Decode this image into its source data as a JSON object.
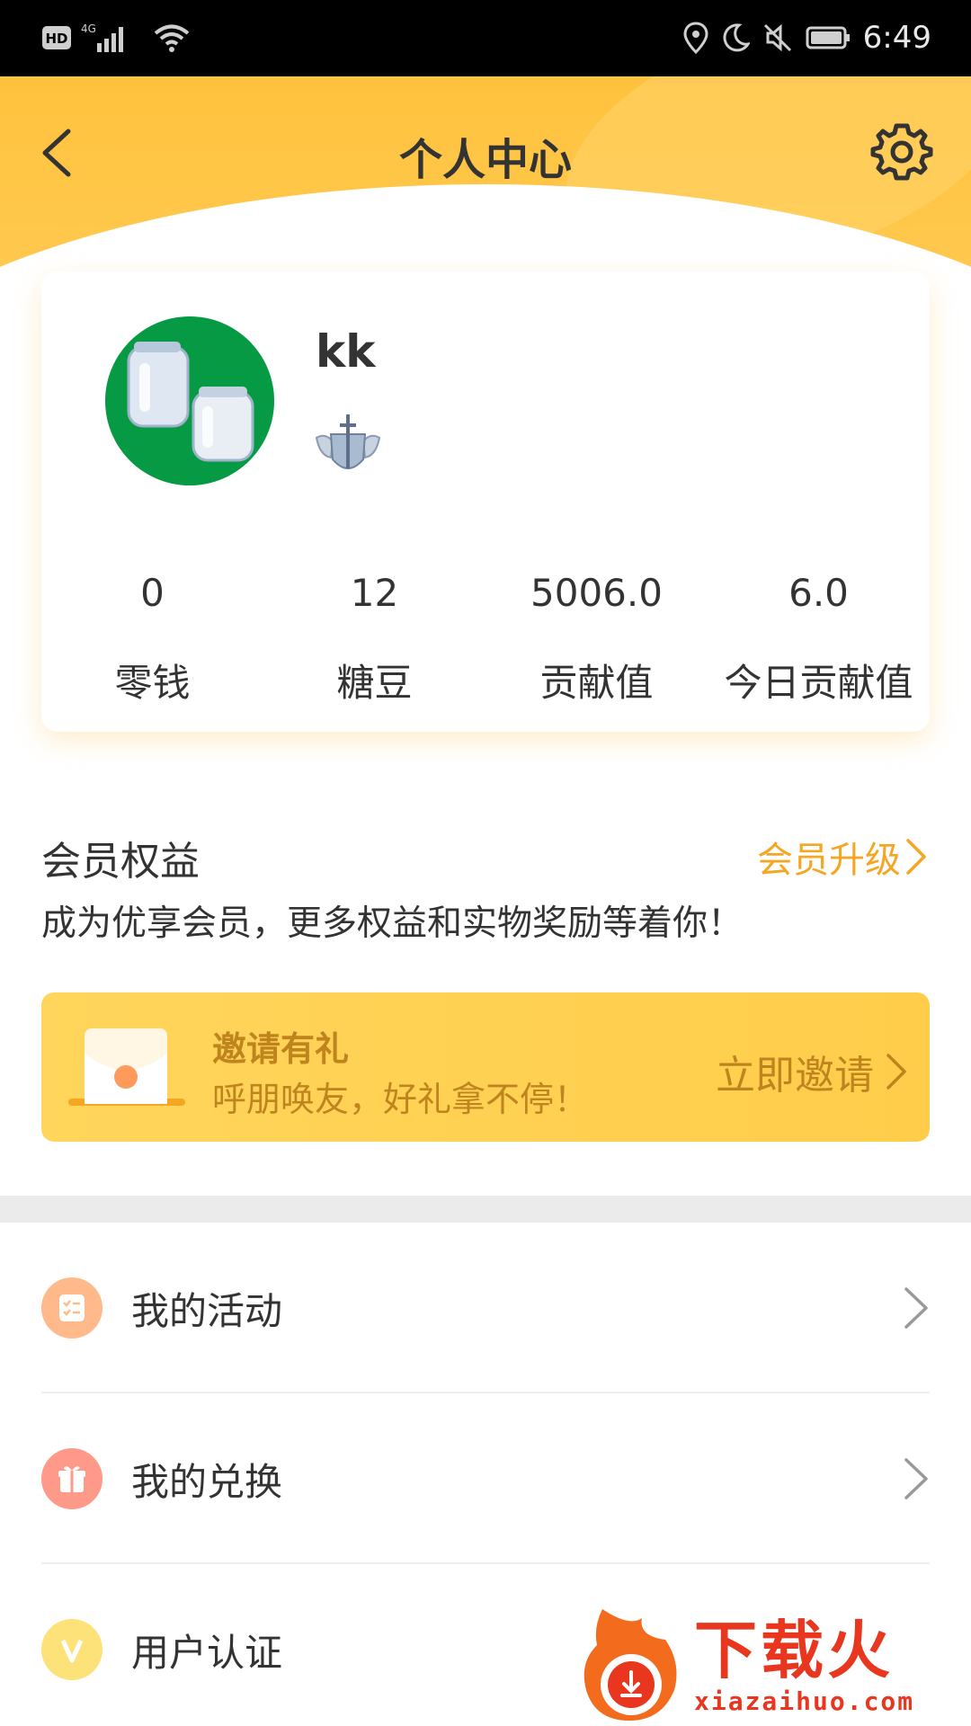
{
  "status_bar": {
    "left_icons": [
      "hd-icon",
      "4g-signal-icon",
      "wifi-icon"
    ],
    "hd_label": "HD",
    "network_label": "4G",
    "right_icons": [
      "location-icon",
      "moon-icon",
      "mute-icon",
      "battery-icon"
    ],
    "time": "6:49"
  },
  "header": {
    "title": "个人中心",
    "back_icon": "chevron-left-icon",
    "settings_icon": "gear-icon"
  },
  "profile": {
    "username": "kk",
    "avatar_icon": "jars-avatar",
    "badge_icon": "shield-sword-badge-icon",
    "stats": [
      {
        "value": "0",
        "label": "零钱"
      },
      {
        "value": "12",
        "label": "糖豆"
      },
      {
        "value": "5006.0",
        "label": "贡献值"
      },
      {
        "value": "6.0",
        "label": "今日贡献值"
      }
    ]
  },
  "membership": {
    "title": "会员权益",
    "upgrade_label": "会员升级",
    "description": "成为优享会员，更多权益和实物奖励等着你！"
  },
  "invite": {
    "title": "邀请有礼",
    "subtitle": "呼朋唤友，好礼拿不停！",
    "action_label": "立即邀请",
    "icon": "envelope-icon"
  },
  "menu": [
    {
      "label": "我的活动",
      "icon": "checklist-icon",
      "color": "#ffb98a"
    },
    {
      "label": "我的兑换",
      "icon": "gift-icon",
      "color": "#ff9a8a"
    },
    {
      "label": "用户认证",
      "icon": "v-badge-icon",
      "color": "#fde27a"
    }
  ],
  "watermark": {
    "text": "下载火",
    "url": "xiazaihuo.com"
  },
  "colors": {
    "header_yellow": "#ffc23d",
    "accent_orange": "#f5a623",
    "invite_text": "#c0841e",
    "watermark_red": "#e8361f"
  }
}
